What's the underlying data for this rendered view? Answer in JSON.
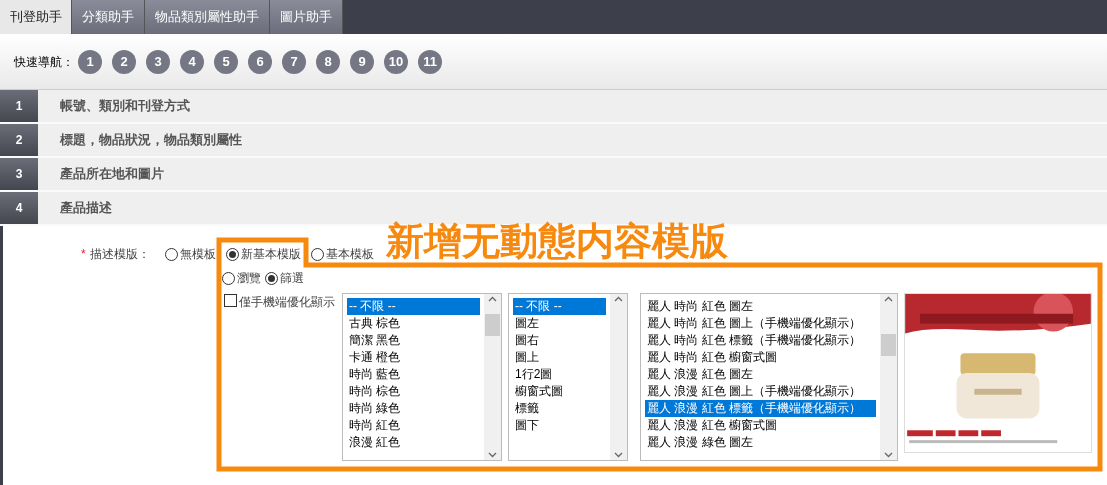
{
  "tabs": [
    {
      "label": "刊登助手",
      "selected": true
    },
    {
      "label": "分類助手",
      "selected": false
    },
    {
      "label": "物品類別屬性助手",
      "selected": false
    },
    {
      "label": "圖片助手",
      "selected": false
    }
  ],
  "quick_nav": {
    "label": "快速導航：",
    "items": [
      "1",
      "2",
      "3",
      "4",
      "5",
      "6",
      "7",
      "8",
      "9",
      "10",
      "11"
    ]
  },
  "sections": [
    {
      "number": "1",
      "title": "帳號、類別和刊登方式"
    },
    {
      "number": "2",
      "title": "標題，物品狀況，物品類別屬性"
    },
    {
      "number": "3",
      "title": "產品所在地和圖片"
    },
    {
      "number": "4",
      "title": "產品描述"
    }
  ],
  "annotation": {
    "text": "新增无動態内容模版"
  },
  "template": {
    "required_mark": "*",
    "label": "描述模版：",
    "options": [
      {
        "label": "無模板",
        "selected": false
      },
      {
        "label": "新基本模版",
        "selected": true
      },
      {
        "label": "基本模板",
        "selected": false
      }
    ],
    "modes": [
      {
        "label": "瀏覽",
        "selected": false
      },
      {
        "label": "篩選",
        "selected": true
      }
    ],
    "mobile_only": {
      "label": "僅手機端優化顯示",
      "checked": false
    },
    "lists": [
      {
        "items": [
          {
            "label": "-- 不限 --",
            "selected": true
          },
          {
            "label": "古典 棕色",
            "selected": false
          },
          {
            "label": "簡潔 黑色",
            "selected": false
          },
          {
            "label": "卡通 橙色",
            "selected": false
          },
          {
            "label": "時尚 藍色",
            "selected": false
          },
          {
            "label": "時尚 棕色",
            "selected": false
          },
          {
            "label": "時尚 綠色",
            "selected": false
          },
          {
            "label": "時尚 紅色",
            "selected": false
          },
          {
            "label": "浪漫 紅色",
            "selected": false
          }
        ]
      },
      {
        "items": [
          {
            "label": "-- 不限 --",
            "selected": true
          },
          {
            "label": "圖左",
            "selected": false
          },
          {
            "label": "圖右",
            "selected": false
          },
          {
            "label": "圖上",
            "selected": false
          },
          {
            "label": "1行2圖",
            "selected": false
          },
          {
            "label": "櫥窗式圖",
            "selected": false
          },
          {
            "label": "標籤",
            "selected": false
          },
          {
            "label": "圖下",
            "selected": false
          }
        ]
      },
      {
        "items": [
          {
            "label": "麗人 時尚 紅色 圖左",
            "selected": false
          },
          {
            "label": "麗人 時尚 紅色 圖上（手機端優化顯示）",
            "selected": false
          },
          {
            "label": "麗人 時尚 紅色 標籤（手機端優化顯示）",
            "selected": false
          },
          {
            "label": "麗人 時尚 紅色 櫥窗式圖",
            "selected": false
          },
          {
            "label": "麗人 浪漫 紅色 圖左",
            "selected": false
          },
          {
            "label": "麗人 浪漫 紅色 圖上（手機端優化顯示）",
            "selected": false
          },
          {
            "label": "麗人 浪漫 紅色 標籤（手機端優化顯示）",
            "selected": true
          },
          {
            "label": "麗人 浪漫 紅色 櫥窗式圖",
            "selected": false
          },
          {
            "label": "麗人 浪漫 綠色 圖左",
            "selected": false
          }
        ]
      }
    ]
  }
}
